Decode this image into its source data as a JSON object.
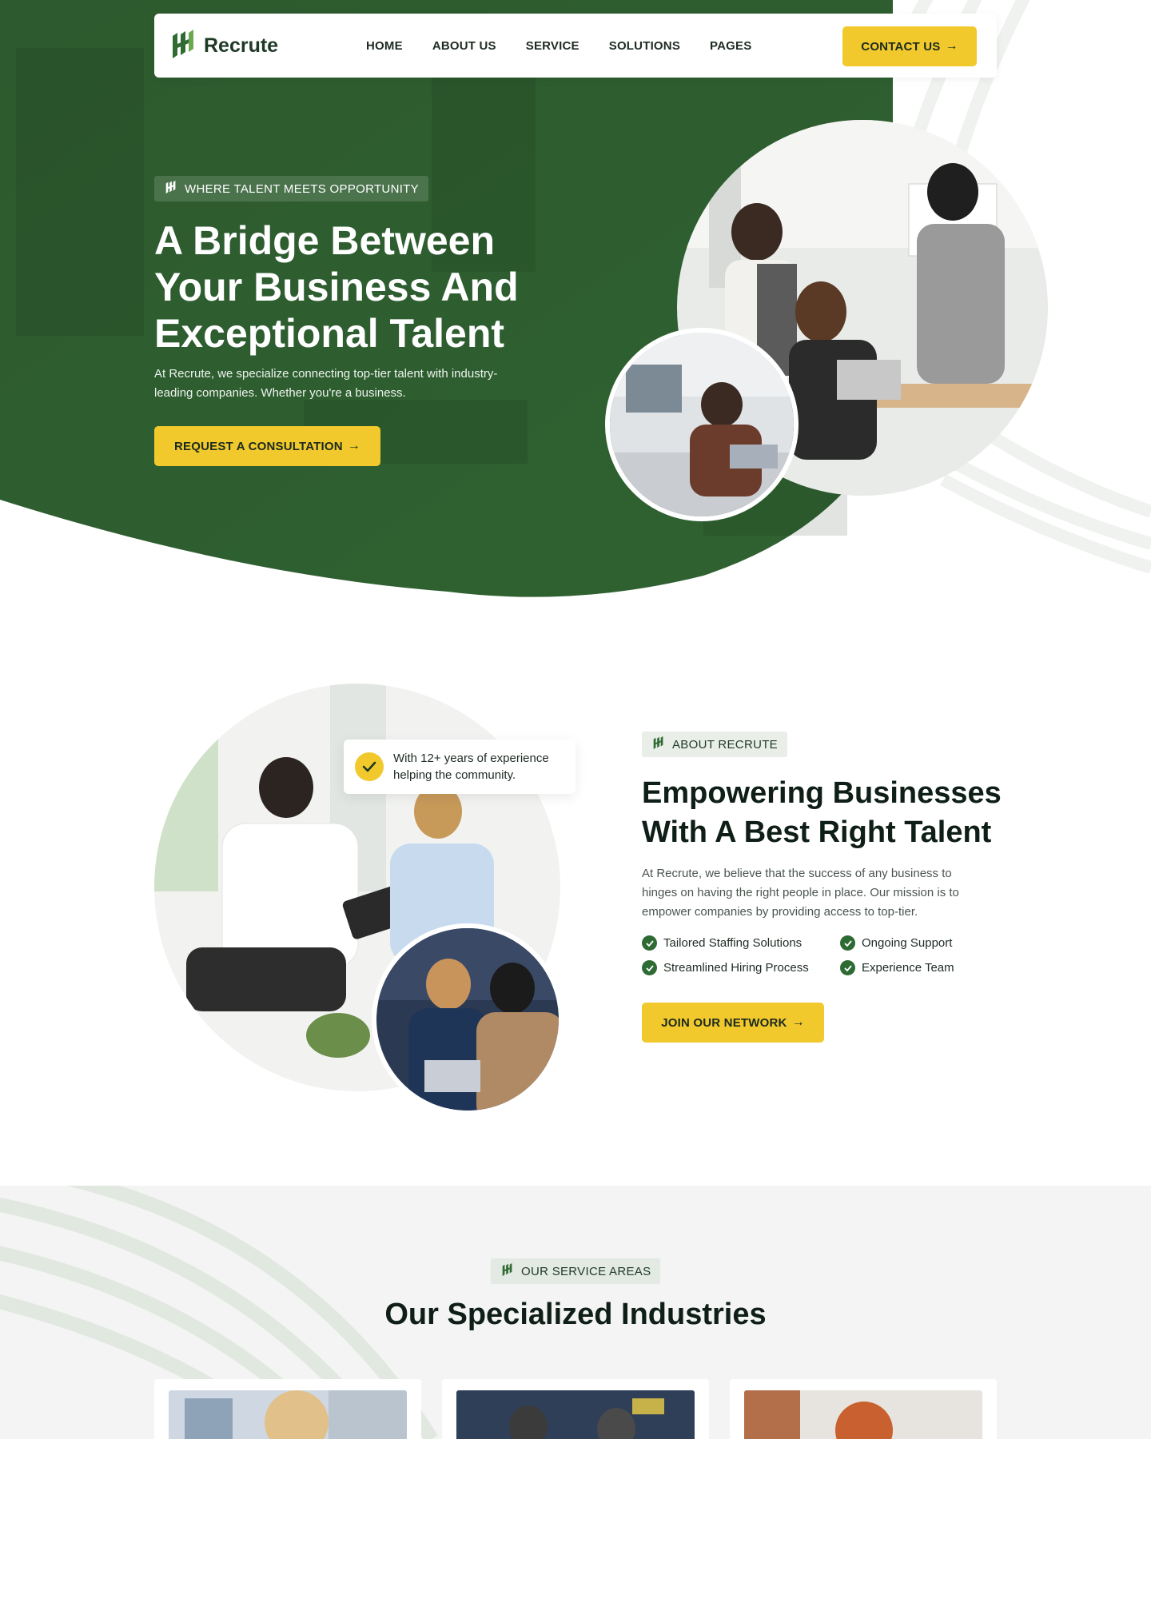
{
  "brand": {
    "name": "Recrute",
    "logo_icon": "recrute-logo-icon"
  },
  "colors": {
    "primary_green": "#2f5d2f",
    "accent_yellow": "#f2c92c",
    "dark_text": "#0f1f17"
  },
  "nav": {
    "links": [
      "HOME",
      "ABOUT US",
      "SERVICE",
      "SOLUTIONS",
      "PAGES"
    ],
    "contact_label": "CONTACT US",
    "arrow_icon": "arrow-right-icon"
  },
  "hero": {
    "tag": "WHERE TALENT MEETS OPPORTUNITY",
    "title": "A Bridge Between Your Business And Exceptional Talent",
    "text": "At Recrute, we specialize connecting top-tier talent with industry-leading companies. Whether you're a business.",
    "cta": "REQUEST A CONSULTATION"
  },
  "about": {
    "badge_text": "With 12+ years of experience helping the community.",
    "tag": "ABOUT RECRUTE",
    "title": "Empowering Businesses With A Best Right Talent",
    "text": "At Recrute, we believe that the success of any business to hinges on having the right people in place. Our mission is to empower companies by providing access to top-tier.",
    "features": [
      "Tailored Staffing Solutions",
      "Ongoing Support",
      "Streamlined Hiring Process",
      "Experience Team"
    ],
    "cta": "JOIN OUR NETWORK"
  },
  "services": {
    "tag": "OUR SERVICE AREAS",
    "title": "Our Specialized Industries"
  }
}
